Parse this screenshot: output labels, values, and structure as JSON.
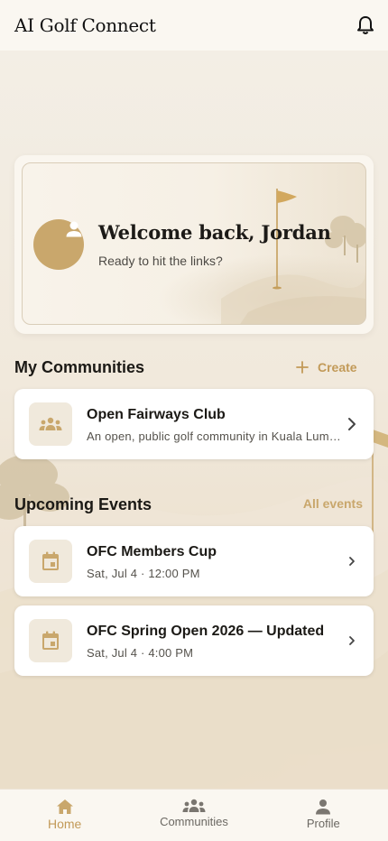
{
  "header": {
    "title": "AI Golf Connect",
    "notifications_icon": "bell-icon"
  },
  "welcome": {
    "title": "Welcome back, Jordan",
    "subtitle": "Ready to hit the links?",
    "avatar_icon": "person-icon"
  },
  "communities": {
    "title": "My Communities",
    "create_label": "Create",
    "items": [
      {
        "name": "Open Fairways Club",
        "description": "An open, public golf community in Kuala Lumpur",
        "icon": "group-icon"
      }
    ]
  },
  "events": {
    "title": "Upcoming Events",
    "all_label": "All events",
    "items": [
      {
        "name": "OFC Members Cup",
        "when": "Sat, Jul 4 · 12:00 PM",
        "icon": "calendar-icon"
      },
      {
        "name": "OFC Spring Open 2026 — Updated",
        "when": "Sat, Jul 4 · 4:00 PM",
        "icon": "calendar-icon"
      }
    ]
  },
  "nav": {
    "items": [
      {
        "label": "Home",
        "icon": "home-icon",
        "active": true
      },
      {
        "label": "Communities",
        "icon": "group-icon",
        "active": false
      },
      {
        "label": "Profile",
        "icon": "person-icon",
        "active": false
      }
    ]
  },
  "colors": {
    "accent": "#c9a76c",
    "accent_text": "#c29a58",
    "background": "#f6f1e8"
  }
}
